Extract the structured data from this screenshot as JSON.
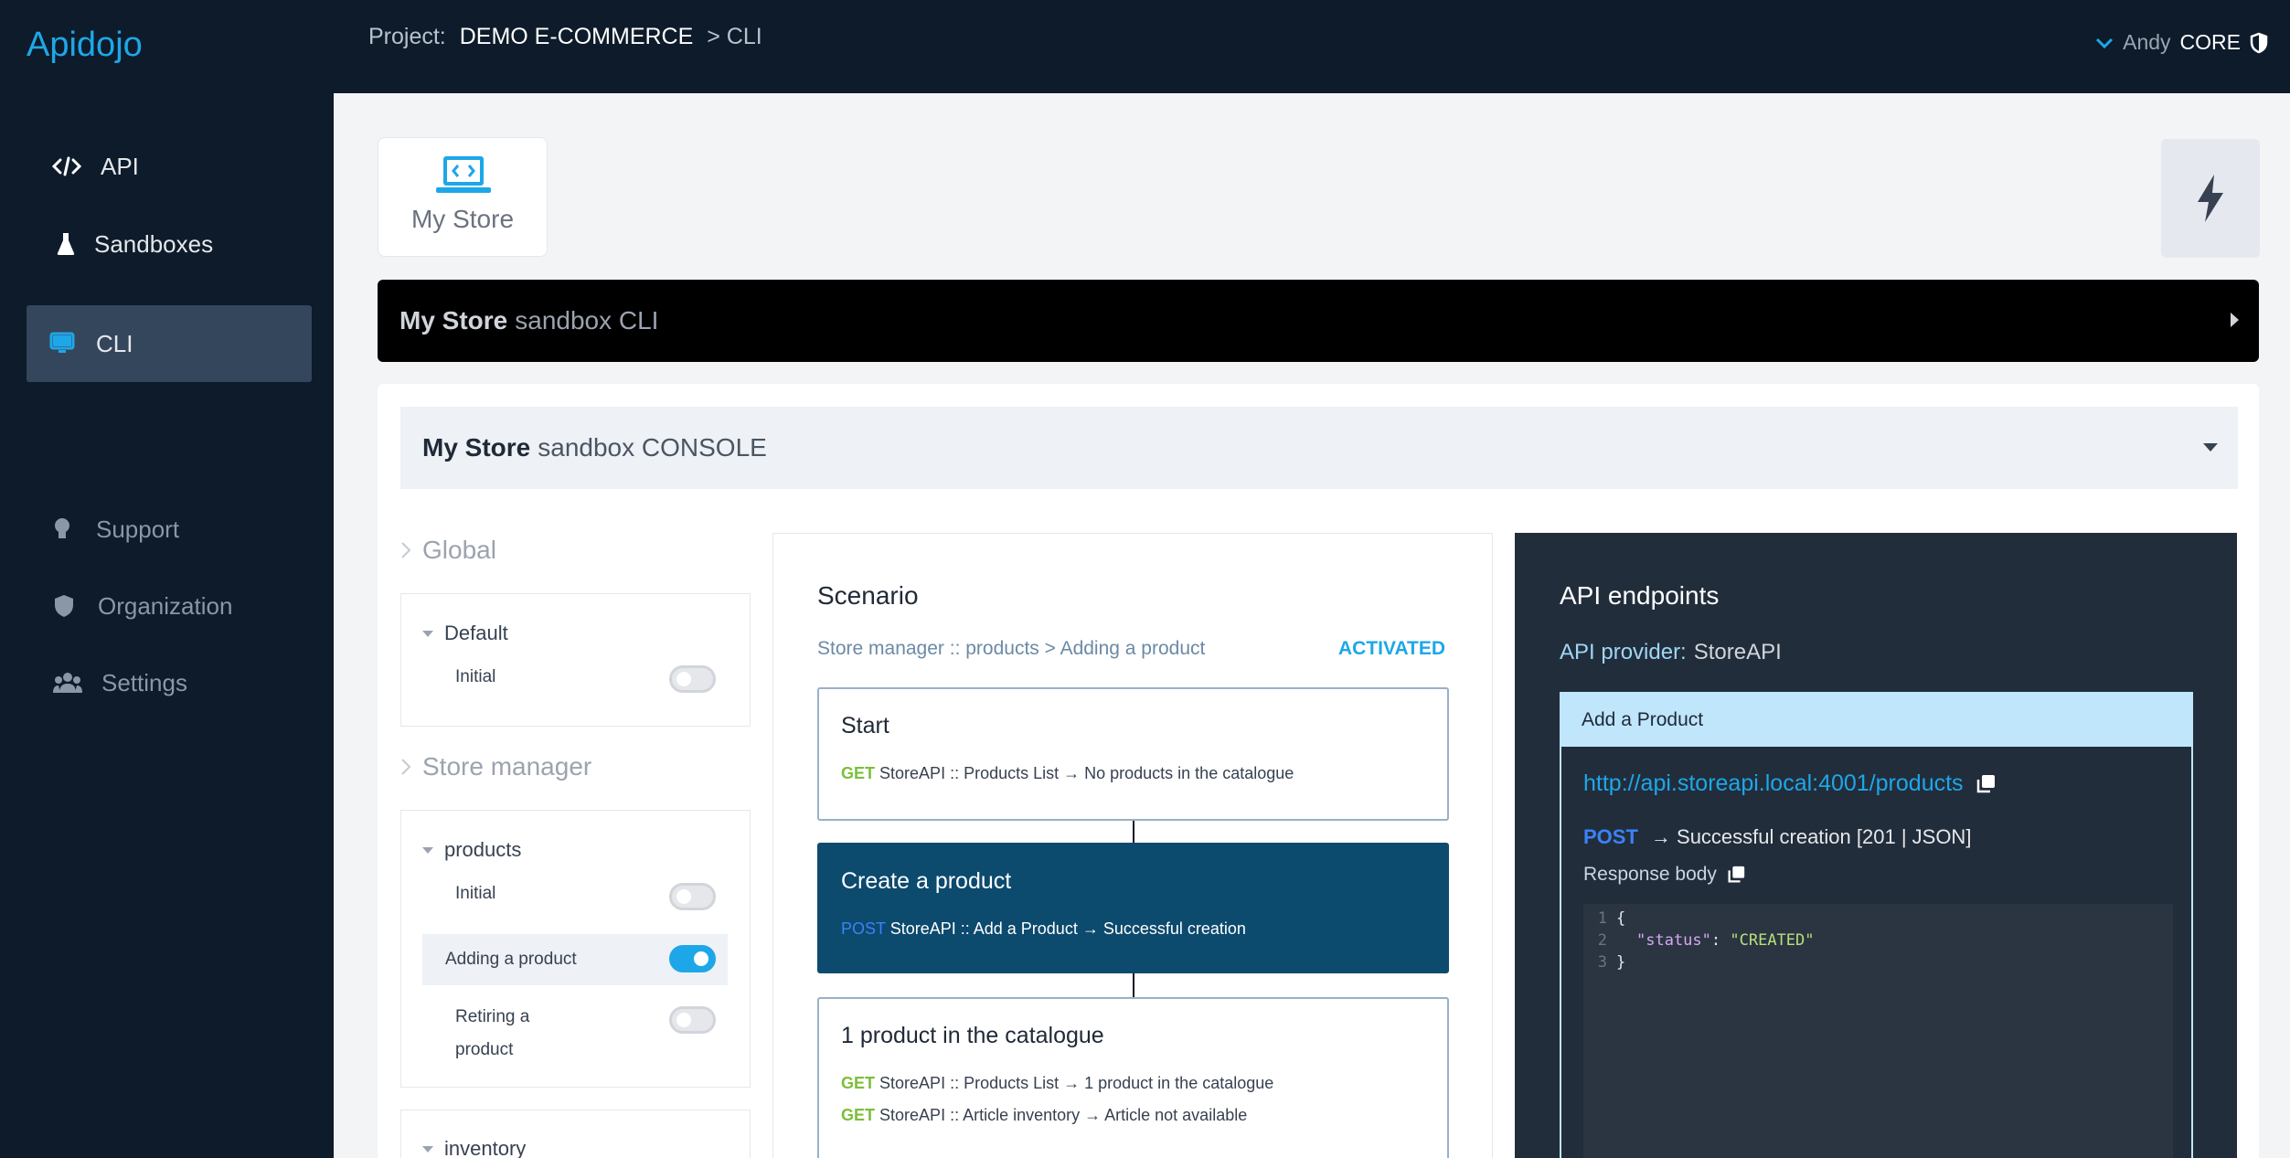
{
  "app": {
    "brand": "Apidojo"
  },
  "sidebar": {
    "items": [
      {
        "label": "API",
        "icon": "code-icon"
      },
      {
        "label": "Sandboxes",
        "icon": "flask-icon"
      },
      {
        "label": "CLI",
        "icon": "monitor-icon",
        "active": true
      },
      {
        "label": "Support",
        "icon": "lightbulb-icon"
      },
      {
        "label": "Organization",
        "icon": "shield-icon"
      },
      {
        "label": "Settings",
        "icon": "users-icon"
      }
    ]
  },
  "topbar": {
    "project_label": "Project:",
    "project_name": "DEMO E-COMMERCE",
    "crumb_tail": "> CLI",
    "user_name": "Andy",
    "user_badge": "CORE"
  },
  "store_tile": {
    "label": "My Store"
  },
  "cli_bar": {
    "bold": "My Store",
    "rest": "sandbox CLI"
  },
  "console": {
    "bold": "My Store",
    "rest": "sandbox CONSOLE"
  },
  "groups": {
    "global": {
      "title": "Global",
      "sub": {
        "title": "Default",
        "items": [
          {
            "label": "Initial",
            "on": false
          }
        ]
      }
    },
    "store_manager": {
      "title": "Store manager",
      "sub": {
        "title": "products",
        "items": [
          {
            "label": "Initial",
            "on": false
          },
          {
            "label": "Adding a product",
            "on": true
          },
          {
            "label_line1": "Retiring a",
            "label_line2": "product",
            "on": false
          }
        ]
      }
    },
    "inventory": {
      "title": "inventory"
    }
  },
  "scenario": {
    "title": "Scenario",
    "path": "Store manager :: products > Adding a product",
    "status": "ACTIVATED",
    "steps": [
      {
        "title": "Start",
        "lines": [
          {
            "method": "GET",
            "text": "StoreAPI :: Products List → No products in the catalogue"
          }
        ]
      },
      {
        "title": "Create a product",
        "lines": [
          {
            "method": "POST",
            "text": "StoreAPI :: Add a Product → Successful creation"
          }
        ]
      },
      {
        "title": "1 product in the catalogue",
        "lines": [
          {
            "method": "GET",
            "text": "StoreAPI :: Products List → 1 product in the catalogue"
          },
          {
            "method": "GET",
            "text": "StoreAPI :: Article inventory → Article not available"
          }
        ]
      }
    ]
  },
  "api": {
    "title": "API endpoints",
    "provider_label": "API provider:",
    "provider": "StoreAPI",
    "endpoint": {
      "name": "Add a Product",
      "url": "http://api.storeapi.local:4001/products",
      "method": "POST",
      "result": "→ Successful creation [201 | JSON]",
      "response_label": "Response body",
      "code": [
        {
          "n": "1",
          "text": "{"
        },
        {
          "n": "2",
          "key": "\"status\"",
          "sep": ": ",
          "val": "\"CREATED\""
        },
        {
          "n": "3",
          "text": "}"
        }
      ]
    }
  },
  "colors": {
    "accent": "#1ea7e8",
    "sidebar": "#0d1b2a",
    "active_step": "#0c4a6e",
    "get": "#7cbf3a",
    "post": "#3b82f6"
  }
}
